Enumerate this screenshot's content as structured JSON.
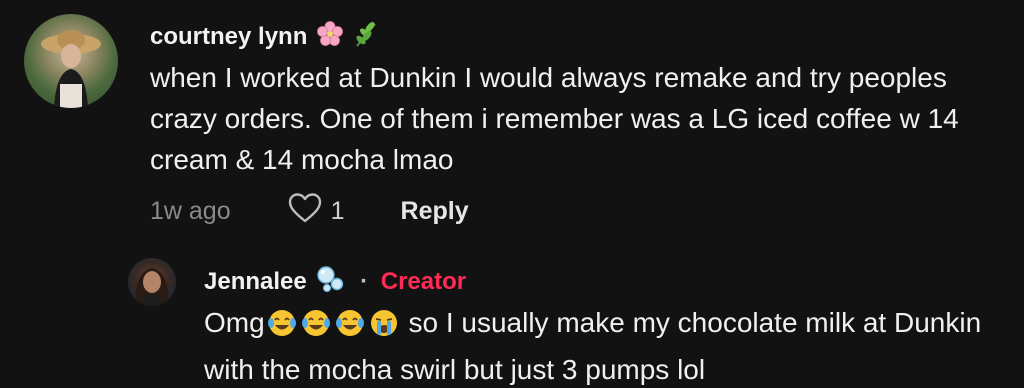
{
  "comment": {
    "username": "courtney lynn",
    "username_emojis": [
      "cherry-blossom-icon",
      "herb-icon"
    ],
    "text": "when I worked at Dunkin I would always remake and try peoples crazy orders. One of them i remember was a LG iced coffee w 14 cream & 14 mocha lmao",
    "time": "1w ago",
    "like_count": "1",
    "reply_label": "Reply"
  },
  "reply": {
    "username": "Jennalee",
    "username_emoji": "bubbles-icon",
    "separator": "·",
    "badge": "Creator",
    "text_prefix": "Omg",
    "text_emojis": [
      "joy-face-icon",
      "joy-face-icon",
      "joy-face-icon",
      "sob-face-icon"
    ],
    "text": "so I usually make my chocolate milk at Dunkin with the mocha swirl but just 3 pumps lol"
  },
  "colors": {
    "background": "#121212",
    "creator_badge": "#fe2c55",
    "meta_text": "#8a8a8a"
  }
}
